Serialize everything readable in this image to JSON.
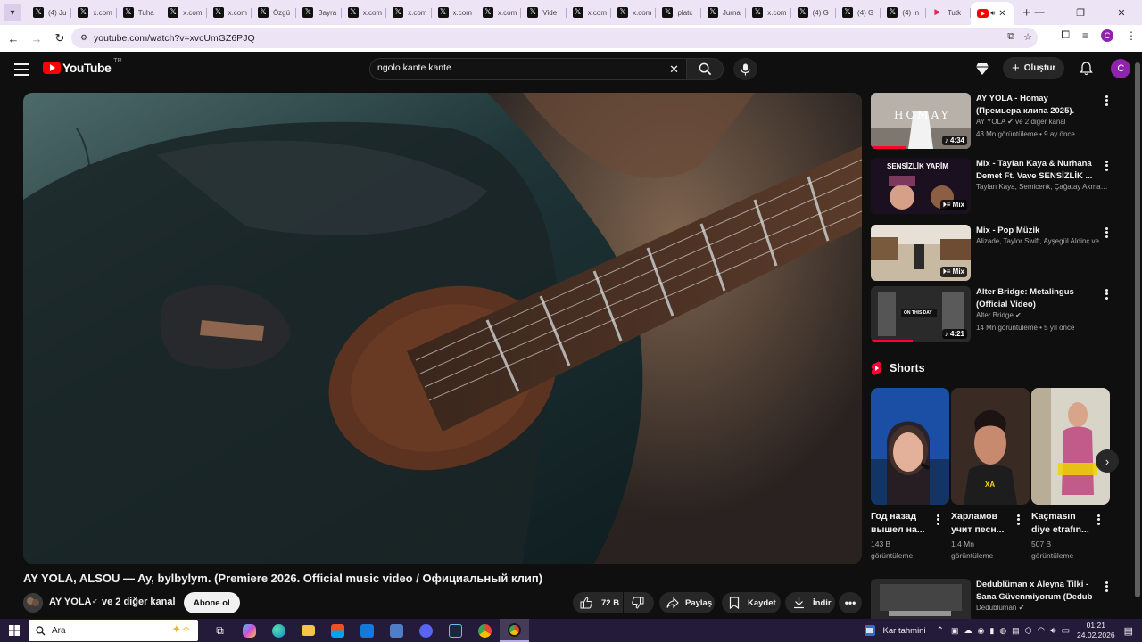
{
  "browser": {
    "tabs": [
      {
        "title": "(4) Ju",
        "favicon": "x-icon"
      },
      {
        "title": "x.com",
        "favicon": "x-icon"
      },
      {
        "title": "Tuha",
        "favicon": "x-icon"
      },
      {
        "title": "x.com",
        "favicon": "x-icon"
      },
      {
        "title": "x.com",
        "favicon": "x-icon"
      },
      {
        "title": "Özgü",
        "favicon": "x-icon"
      },
      {
        "title": "Bayra",
        "favicon": "x-icon"
      },
      {
        "title": "x.com",
        "favicon": "x-icon"
      },
      {
        "title": "x.com",
        "favicon": "x-icon"
      },
      {
        "title": "x.com",
        "favicon": "x-icon"
      },
      {
        "title": "x.com",
        "favicon": "x-icon"
      },
      {
        "title": "Vide",
        "favicon": "x-icon"
      },
      {
        "title": "x.com",
        "favicon": "x-icon"
      },
      {
        "title": "x.com",
        "favicon": "x-icon"
      },
      {
        "title": "platc",
        "favicon": "x-icon"
      },
      {
        "title": "Jurna",
        "favicon": "x-icon"
      },
      {
        "title": "x.com",
        "favicon": "x-icon"
      },
      {
        "title": "(4) G",
        "favicon": "x-icon"
      },
      {
        "title": "(4) G",
        "favicon": "x-icon"
      },
      {
        "title": "(4) In",
        "favicon": "x-icon"
      },
      {
        "title": "Tutk",
        "favicon": "tiktok-icon"
      }
    ],
    "url": "youtube.com/watch?v=xvcUmGZ6PJQ"
  },
  "youtube": {
    "logo_text": "YouTube",
    "country_code": "TR",
    "search": {
      "value": "ngolo kante kante",
      "placeholder": "Ara"
    },
    "create_label": "Oluştur",
    "avatar_letter": "C"
  },
  "video": {
    "title": "AY YOLA, ALSOU — Ay, bylbylym. (Premiere 2026. Official music video / Официальный клип)",
    "channel": "AY YOLA",
    "other_channels": "ve 2 diğer kanal",
    "subscribe_label": "Abone ol",
    "likes": "72 B",
    "share_label": "Paylaş",
    "save_label": "Kaydet",
    "download_label": "İndir"
  },
  "recommendations": [
    {
      "title": "AY YOLA - Homay (Премьера клипа 2025). Официальный ...",
      "channel": "AY YOLA",
      "channel_extra": "ve 2 diğer kanal",
      "meta": "43 Mn görüntüleme • 9 ay önce",
      "duration": "4:34",
      "thumb_text": "HOMAY",
      "progress": 0.35
    },
    {
      "title": "Mix - Taylan Kaya & Nurhana Demet Ft. Vave  SENSİZLİK ...",
      "channel": "Taylan Kaya, Semicenk, Çağatay Akman ...",
      "meta": "",
      "duration": "Mix",
      "thumb_text": "SENSİZLİK YARİM"
    },
    {
      "title": "Mix - Pop Müzik",
      "channel": "Alizade, Taylor Swift, Ayşegül Aldinç ve d...",
      "meta": "",
      "duration": "Mix"
    },
    {
      "title": "Alter Bridge: Metalingus (Official Video)",
      "channel": "Alter Bridge",
      "meta": "14 Mn görüntüleme • 5 yıl önce",
      "duration": "4:21",
      "thumb_text": "ON THIS DAY",
      "progress": 0.42
    },
    {
      "title": "Dedublüman x Aleyna Tilki - Sana Güvenmiyorum (Dedub ...",
      "channel": "Dedublüman",
      "meta": "",
      "duration": ""
    }
  ],
  "shorts": {
    "heading": "Shorts",
    "items": [
      {
        "title": "Год назад вышел на...",
        "views": "143 B görüntüleme"
      },
      {
        "title": "Харламов учит песн...",
        "views": "1,4 Mn görüntüleme",
        "thumb_text": "XA"
      },
      {
        "title": "Kaçmasın diye etrafın...",
        "views": "507 B görüntüleme"
      }
    ]
  },
  "taskbar": {
    "search_text": "Ara",
    "weather": "Kar tahmini",
    "time": "01:21",
    "date": "24.02.2026"
  }
}
